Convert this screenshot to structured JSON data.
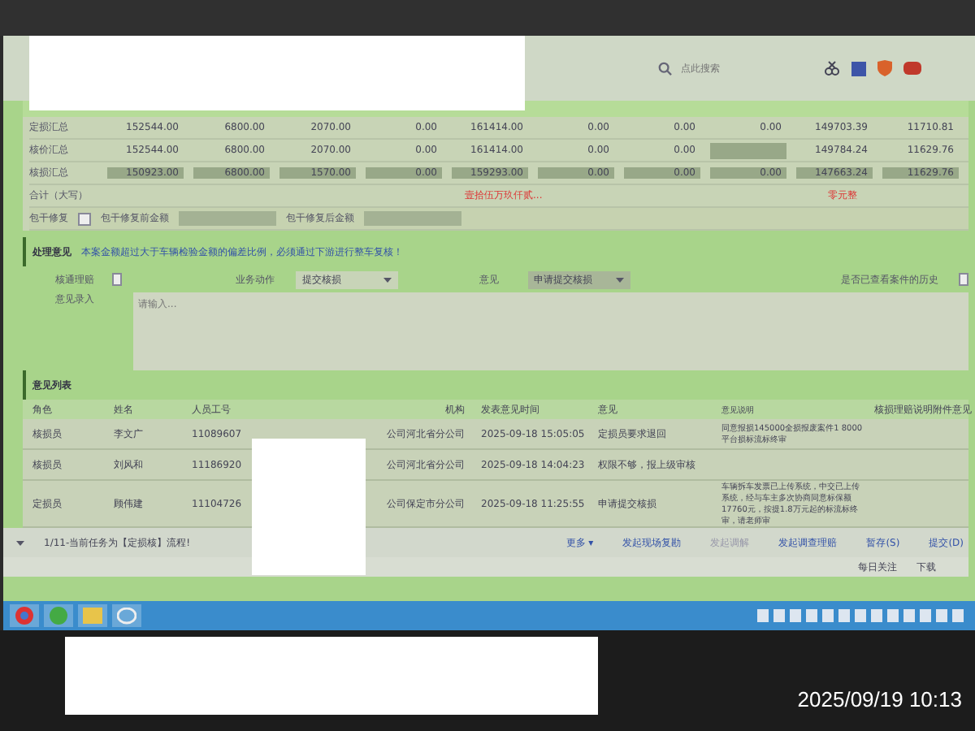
{
  "browser": {
    "search_placeholder": "点此搜索"
  },
  "summary": {
    "rows": [
      {
        "label": "定损汇总",
        "highlighted": false,
        "cells": [
          "152544.00",
          "6800.00",
          "2070.00",
          "0.00",
          "161414.00",
          "0.00",
          "0.00",
          "0.00",
          "149703.39",
          "11710.81"
        ]
      },
      {
        "label": "核价汇总",
        "highlighted": false,
        "cells": [
          "152544.00",
          "6800.00",
          "2070.00",
          "0.00",
          "161414.00",
          "0.00",
          "0.00",
          "",
          "149784.24",
          "11629.76"
        ]
      },
      {
        "label": "核损汇总",
        "highlighted": true,
        "cells": [
          "150923.00",
          "6800.00",
          "1570.00",
          "0.00",
          "159293.00",
          "0.00",
          "0.00",
          "0.00",
          "147663.24",
          "11629.76"
        ]
      }
    ],
    "total_label": "合计（大写）",
    "total_text": "壹拾伍万玖仟贰...",
    "total_unit": "零元整",
    "package_label": "包干修复",
    "package_checked": false,
    "before_label": "包干修复前金额",
    "after_label": "包干修复后金额"
  },
  "opinion": {
    "title": "处理意见",
    "note": "本案金额超过大于车辆检验金额的偏差比例，必须通过下游进行整车复核！",
    "fast_label": "核通理赔",
    "fast_checked": false,
    "action_label": "业务动作",
    "action_value": "提交核损",
    "opinion_label": "意见",
    "opinion_value": "申请提交核损",
    "history_label": "是否已查看案件的历史",
    "history_checked": false,
    "input_label": "意见录入",
    "placeholder": "请输入..."
  },
  "list": {
    "title": "意见列表",
    "columns": [
      "角色",
      "姓名",
      "人员工号",
      "机构",
      "发表意见时间",
      "意见",
      "意见说明",
      "核损理赔说明附件意见"
    ],
    "rows": [
      {
        "cells": [
          "核损员",
          "李文广",
          "11089607",
          "公司河北省分公司",
          "2025-09-18 15:05:05",
          "定损员要求退回",
          "同意报损145000全损报废案件1 8000平台损标流标终审"
        ]
      },
      {
        "cells": [
          "核损员",
          "刘风和",
          "11186920",
          "公司河北省分公司",
          "2025-09-18 14:04:23",
          "权限不够，报上级审核",
          ""
        ]
      },
      {
        "cells": [
          "定损员",
          "顾伟建",
          "11104726",
          "公司保定市分公司",
          "2025-09-18 11:25:55",
          "申请提交核损",
          "车辆拆车发票已上传系统，中交已上传系统，经与车主多次协商同意标保额17760元，按提1.8万元起的标流标终审，请老师审"
        ]
      }
    ]
  },
  "footer": {
    "task": "1/11-当前任务为【定损核】流程!",
    "buttons": [
      {
        "label": "更多 ▾",
        "disabled": false
      },
      {
        "label": "发起现场复勘",
        "disabled": false
      },
      {
        "label": "发起调解",
        "disabled": true
      },
      {
        "label": "发起调查理赔",
        "disabled": false
      },
      {
        "label": "暂存(S)",
        "disabled": false
      },
      {
        "label": "提交(D)",
        "disabled": false
      }
    ]
  },
  "status": {
    "items": [
      "每日关注",
      "下载"
    ]
  },
  "photo": {
    "timestamp": "2025/09/19 10:13"
  }
}
